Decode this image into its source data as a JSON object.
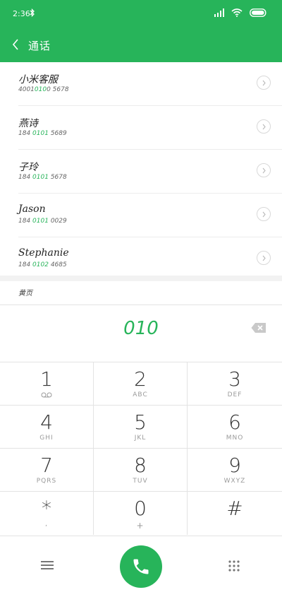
{
  "status_bar": {
    "time": "2:36"
  },
  "header": {
    "title": "通话"
  },
  "contacts": [
    {
      "name": "小米客服",
      "number_pre": "4001",
      "number_hl": "010",
      "number_post": "0 5678"
    },
    {
      "name": "燕诗",
      "number_pre": "184 ",
      "number_hl": "0101",
      "number_post": " 5689"
    },
    {
      "name": "子玲",
      "number_pre": "184 ",
      "number_hl": "0101",
      "number_post": " 5678"
    },
    {
      "name": "Jason",
      "number_pre": "184 ",
      "number_hl": "0101",
      "number_post": " 0029"
    },
    {
      "name": "Stephanie",
      "number_pre": "184 ",
      "number_hl": "0102",
      "number_post": " 4685"
    }
  ],
  "section_label": "黄页",
  "dialer": {
    "number": "010"
  },
  "keys": [
    {
      "digit": "1",
      "letters": ""
    },
    {
      "digit": "2",
      "letters": "ABC"
    },
    {
      "digit": "3",
      "letters": "DEF"
    },
    {
      "digit": "4",
      "letters": "GHI"
    },
    {
      "digit": "5",
      "letters": "JKL"
    },
    {
      "digit": "6",
      "letters": "MNO"
    },
    {
      "digit": "7",
      "letters": "PQRS"
    },
    {
      "digit": "8",
      "letters": "TUV"
    },
    {
      "digit": "9",
      "letters": "WXYZ"
    },
    {
      "digit": "*",
      "letters": ","
    },
    {
      "digit": "0",
      "letters": "+"
    },
    {
      "digit": "#",
      "letters": ""
    }
  ],
  "icons": {
    "back": "chevron-left-icon",
    "row_action": "chevron-right-icon",
    "voicemail": "voicemail-icon",
    "backspace": "backspace-icon",
    "menu": "menu-icon",
    "call": "phone-icon",
    "dialpad": "dialpad-icon"
  },
  "colors": {
    "accent": "#27b45a",
    "divider": "#e3e3e3"
  }
}
